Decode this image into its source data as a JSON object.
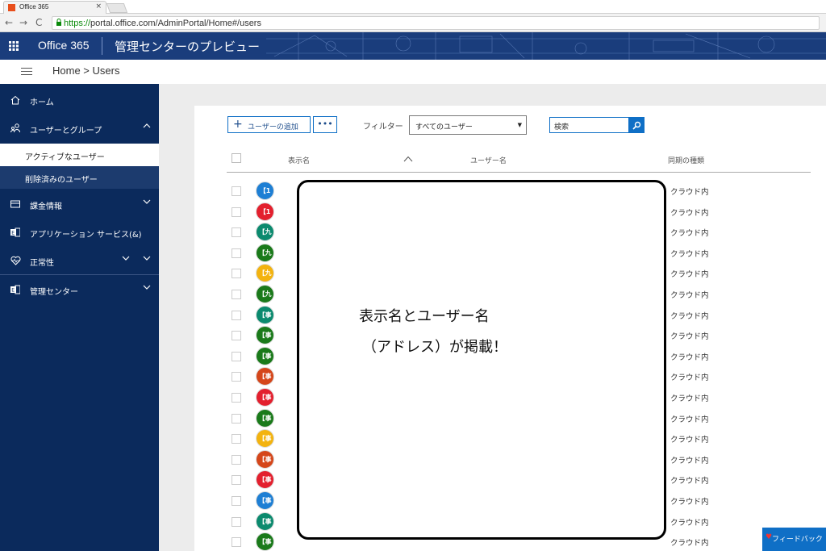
{
  "browser": {
    "tab_title": "Office 365",
    "tab_close": "×",
    "url_scheme": "https://",
    "url_rest": "portal.office.com/AdminPortal/Home#/users"
  },
  "header": {
    "brand": "Office 365",
    "app_title": "管理センターのプレビュー"
  },
  "breadcrumb": "Home > Users",
  "sidebar": {
    "items": [
      {
        "label": "ホーム",
        "icon": "home-icon"
      },
      {
        "label": "ユーザーとグループ",
        "icon": "users-icon",
        "expanded": true
      },
      {
        "label": "課金情報",
        "icon": "billing-icon"
      },
      {
        "label": "アプリケーション サービス(&)",
        "icon": "exchange-icon"
      },
      {
        "label": "正常性",
        "icon": "health-icon"
      },
      {
        "label": "管理センター",
        "icon": "admin-center-icon"
      }
    ],
    "subitems": [
      {
        "label": "アクティブなユーザー"
      },
      {
        "label": "削除済みのユーザー"
      }
    ]
  },
  "toolbar": {
    "add_user": "ユーザーの追加",
    "more": "•••",
    "filter_label": "フィルター",
    "filter_value": "すべてのユーザー",
    "search_placeholder": "検索"
  },
  "table": {
    "columns": [
      "表示名",
      "ユーザー名",
      "同期の種類"
    ],
    "rows": [
      {
        "avatar": "【1",
        "color": "#1e7fd4",
        "sync": "クラウド内"
      },
      {
        "avatar": "【1",
        "color": "#e3202e",
        "sync": "クラウド内"
      },
      {
        "avatar": "【九",
        "color": "#0b8a6e",
        "sync": "クラウド内"
      },
      {
        "avatar": "【九",
        "color": "#1a7a1a",
        "sync": "クラウド内"
      },
      {
        "avatar": "【九",
        "color": "#f3b30f",
        "sync": "クラウド内"
      },
      {
        "avatar": "【九",
        "color": "#1a7a1a",
        "sync": "クラウド内"
      },
      {
        "avatar": "【事",
        "color": "#0b8a6e",
        "sync": "クラウド内"
      },
      {
        "avatar": "【事",
        "color": "#1a7a1a",
        "sync": "クラウド内"
      },
      {
        "avatar": "【事",
        "color": "#1a7a1a",
        "sync": "クラウド内"
      },
      {
        "avatar": "【事",
        "color": "#d5461a",
        "sync": "クラウド内"
      },
      {
        "avatar": "【事",
        "color": "#e3202e",
        "sync": "クラウド内"
      },
      {
        "avatar": "【事",
        "color": "#1a7a1a",
        "sync": "クラウド内"
      },
      {
        "avatar": "【事",
        "color": "#f3b30f",
        "sync": "クラウド内"
      },
      {
        "avatar": "【事",
        "color": "#d5461a",
        "sync": "クラウド内"
      },
      {
        "avatar": "【事",
        "color": "#e3202e",
        "sync": "クラウド内"
      },
      {
        "avatar": "【事",
        "color": "#1e7fd4",
        "sync": "クラウド内"
      },
      {
        "avatar": "【事",
        "color": "#0b8a6e",
        "sync": "クラウド内"
      },
      {
        "avatar": "【事",
        "color": "#1a7a1a",
        "sync": "クラウド内"
      }
    ]
  },
  "annotation": {
    "line1": "表示名とユーザー名",
    "line2": "（アドレス）が掲載！"
  },
  "feedback": "フィードバック"
}
